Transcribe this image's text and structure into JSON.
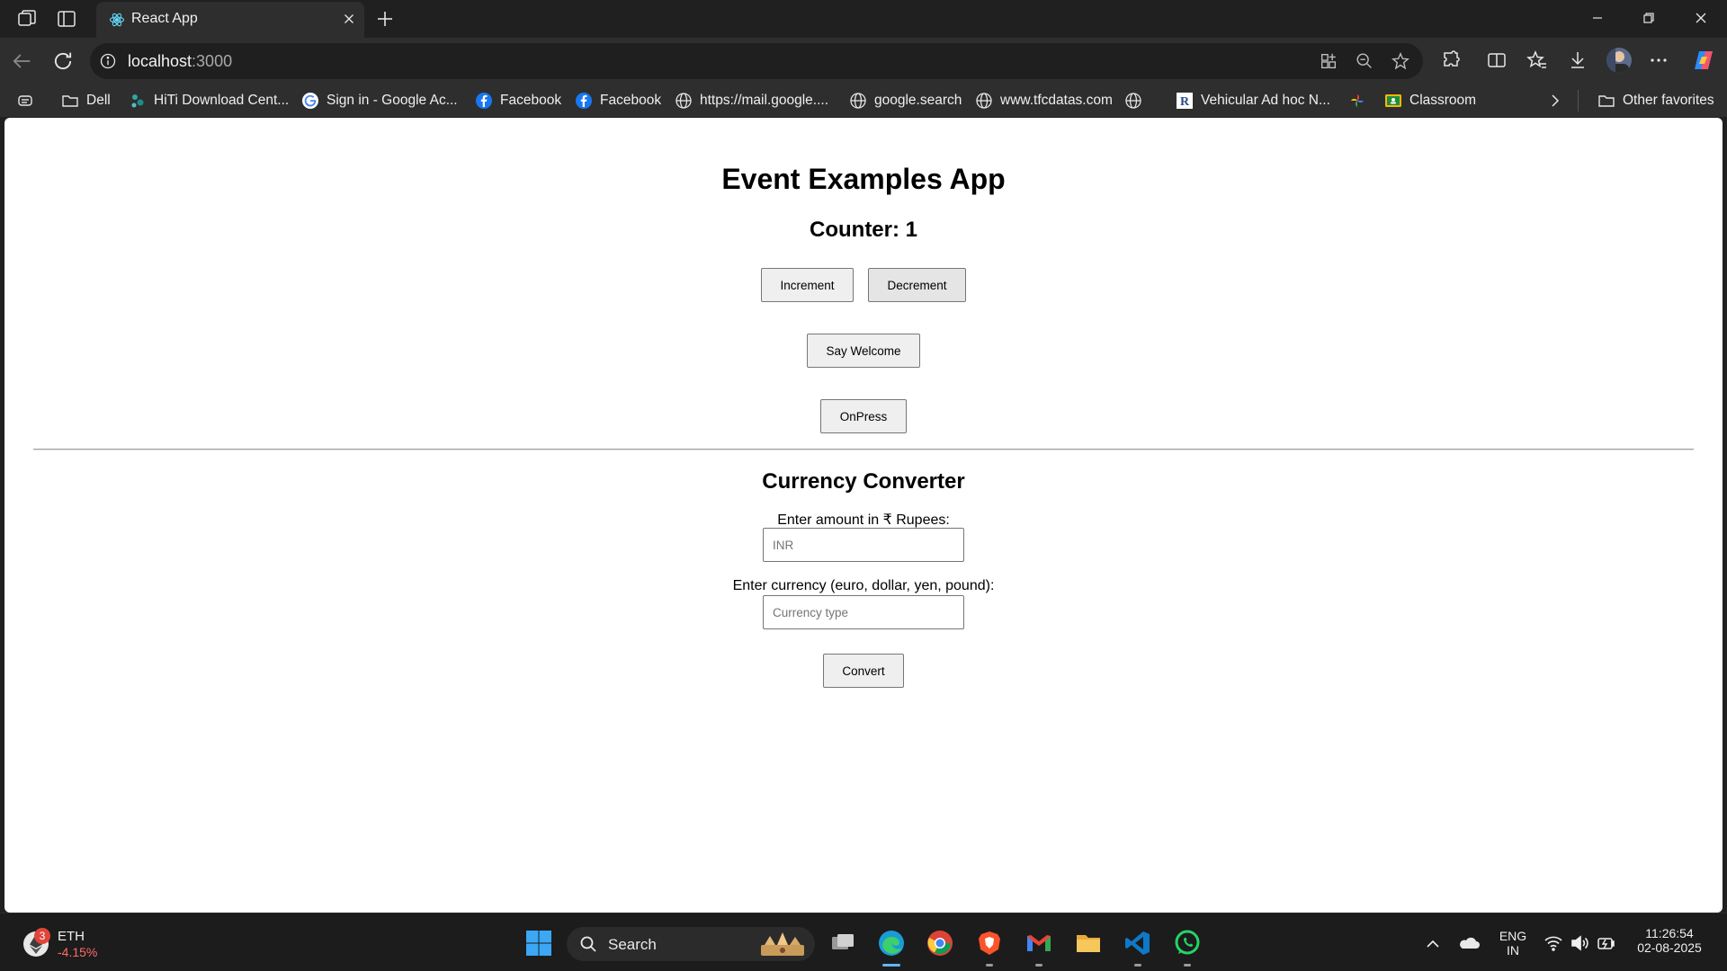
{
  "browser": {
    "tab_title": "React App",
    "url_host": "localhost",
    "url_port": ":3000"
  },
  "favorites": [
    {
      "label": "",
      "icon": "reading-list-icon"
    },
    {
      "label": "Dell",
      "icon": "folder-icon"
    },
    {
      "label": "HiTi Download Cent...",
      "icon": "hiti-icon"
    },
    {
      "label": "Sign in - Google Ac...",
      "icon": "google-icon"
    },
    {
      "label": "Facebook",
      "icon": "facebook-icon"
    },
    {
      "label": "Facebook",
      "icon": "facebook-icon"
    },
    {
      "label": "https://mail.google....",
      "icon": "globe-icon"
    },
    {
      "label": "google.search",
      "icon": "globe-icon"
    },
    {
      "label": "www.tfcdatas.com",
      "icon": "globe-icon"
    },
    {
      "label": "",
      "icon": "globe-icon"
    },
    {
      "label": "Vehicular Ad hoc N...",
      "icon": "r-icon"
    },
    {
      "label": "",
      "icon": "pinwheel-icon"
    },
    {
      "label": "Classroom",
      "icon": "classroom-icon"
    },
    {
      "label": "Other favorites",
      "icon": "folder-icon"
    }
  ],
  "page": {
    "title": "Event Examples App",
    "counter_heading": "Counter: 1",
    "increment_label": "Increment",
    "decrement_label": "Decrement",
    "welcome_label": "Say Welcome",
    "onpress_label": "OnPress",
    "converter_heading": "Currency Converter",
    "amount_label": "Enter amount in ₹ Rupees:",
    "amount_placeholder": "INR",
    "amount_value": "",
    "currency_label": "Enter currency (euro, dollar, yen, pound):",
    "currency_placeholder": "Currency type",
    "currency_value": "",
    "convert_label": "Convert"
  },
  "taskbar": {
    "widget_name": "ETH",
    "widget_change": "-4.15%",
    "widget_badge": "3",
    "search_label": "Search",
    "lang_top": "ENG",
    "lang_bottom": "IN",
    "time": "11:26:54",
    "date": "02-08-2025"
  },
  "colors": {
    "accent_negative": "#ff6b6b",
    "badge": "#e0443a"
  }
}
